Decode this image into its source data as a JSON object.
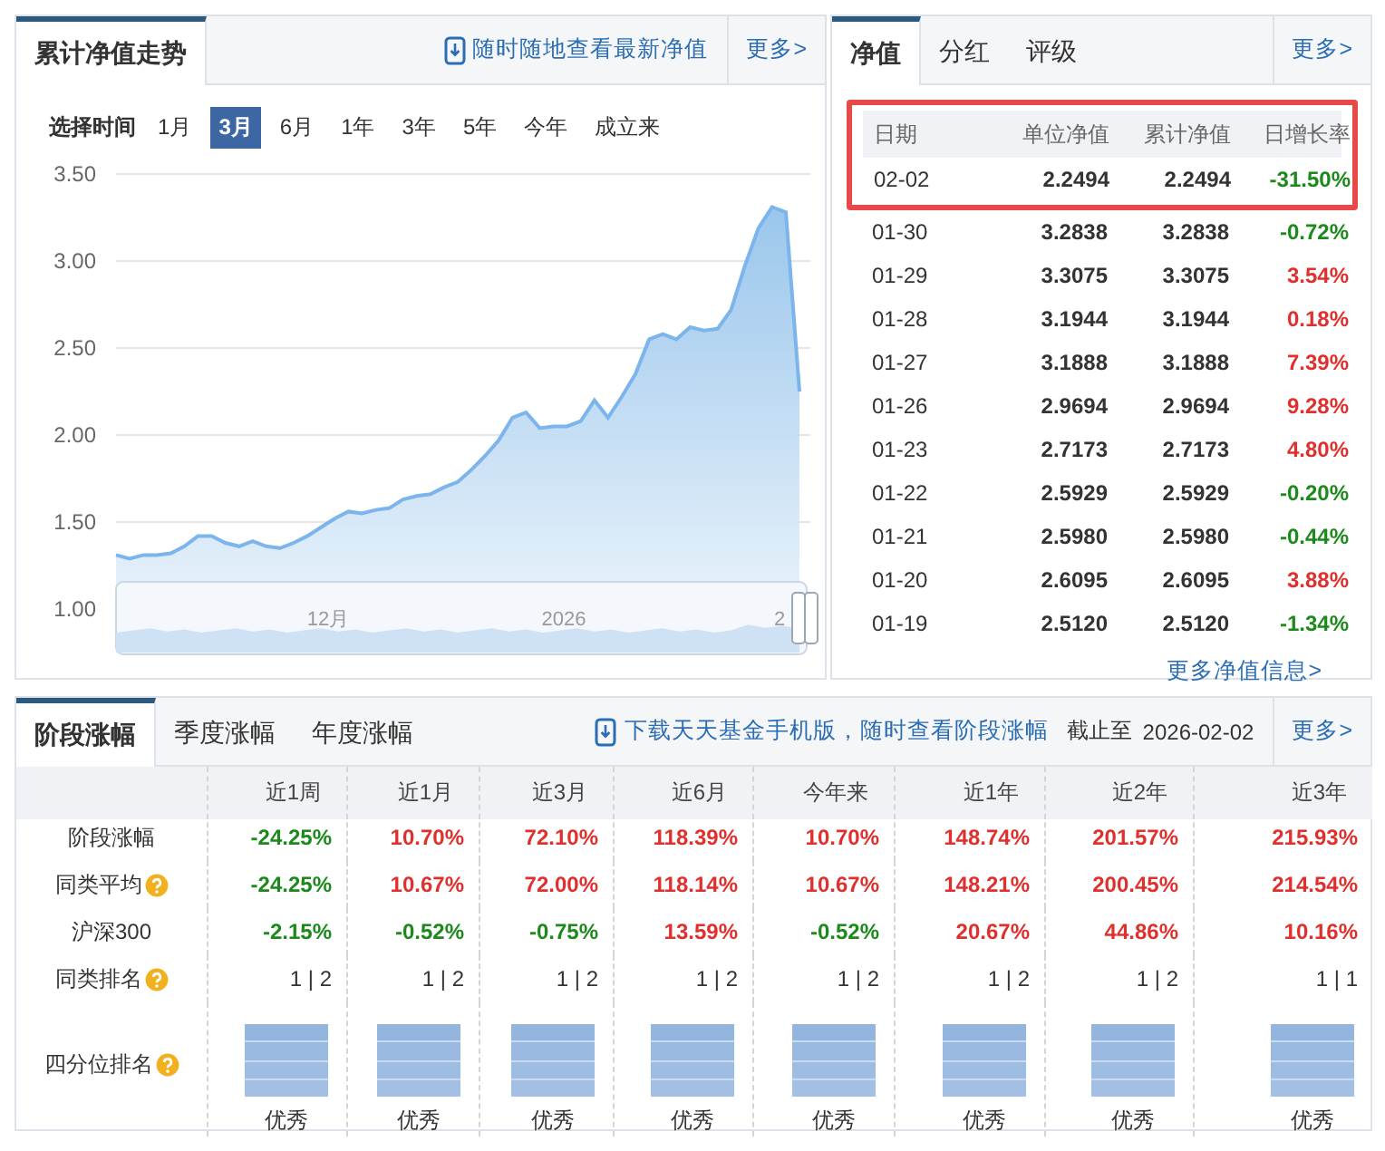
{
  "trend_panel": {
    "tabs": [
      {
        "label": "累计净值走势",
        "selected": true
      }
    ],
    "link": "随时随地查看最新净值",
    "more": "更多>",
    "range_label": "选择时间",
    "ranges": [
      {
        "label": "1月",
        "selected": false
      },
      {
        "label": "3月",
        "selected": true
      },
      {
        "label": "6月",
        "selected": false
      },
      {
        "label": "1年",
        "selected": false
      },
      {
        "label": "3年",
        "selected": false
      },
      {
        "label": "5年",
        "selected": false
      },
      {
        "label": "今年",
        "selected": false
      },
      {
        "label": "成立来",
        "selected": false
      }
    ],
    "chart_data": {
      "type": "area",
      "grid": true,
      "ylim": [
        1,
        3.5
      ],
      "yticks": [
        {
          "value": 1,
          "label": "1.00"
        },
        {
          "value": 1.5,
          "label": "1.50"
        },
        {
          "value": 2,
          "label": "2.00"
        },
        {
          "value": 2.5,
          "label": "2.50"
        },
        {
          "value": 3,
          "label": "3.00"
        },
        {
          "value": 3.5,
          "label": "3.50"
        }
      ],
      "series": [
        {
          "color": "#7cb5ec",
          "values": [
            1.31,
            1.29,
            1.31,
            1.31,
            1.32,
            1.36,
            1.42,
            1.42,
            1.38,
            1.36,
            1.39,
            1.36,
            1.35,
            1.38,
            1.42,
            1.47,
            1.52,
            1.56,
            1.55,
            1.57,
            1.58,
            1.63,
            1.65,
            1.66,
            1.7,
            1.73,
            1.8,
            1.88,
            1.97,
            2.1,
            2.13,
            2.04,
            2.05,
            2.05,
            2.08,
            2.2,
            2.1,
            2.22,
            2.35,
            2.55,
            2.58,
            2.55,
            2.62,
            2.6,
            2.61,
            2.72,
            2.97,
            3.19,
            3.31,
            3.28,
            2.25
          ]
        }
      ]
    },
    "navigator_labels": [
      "12月",
      "2026",
      "2"
    ]
  },
  "nav_panel": {
    "tabs": [
      {
        "label": "净值",
        "selected": true
      },
      {
        "label": "分红",
        "selected": false
      },
      {
        "label": "评级",
        "selected": false
      }
    ],
    "more": "更多>",
    "columns": [
      "日期",
      "单位净值",
      "累计净值",
      "日增长率"
    ],
    "rows": [
      {
        "date": "02-02",
        "unit": "2.2494",
        "accum": "2.2494",
        "change": "-31.50%",
        "color": "#1b8a1b",
        "highlighted": true
      },
      {
        "date": "01-30",
        "unit": "3.2838",
        "accum": "3.2838",
        "change": "-0.72%",
        "color": "#1b8a1b",
        "highlighted": false
      },
      {
        "date": "01-29",
        "unit": "3.3075",
        "accum": "3.3075",
        "change": "3.54%",
        "color": "#e0302d",
        "highlighted": false
      },
      {
        "date": "01-28",
        "unit": "3.1944",
        "accum": "3.1944",
        "change": "0.18%",
        "color": "#e0302d",
        "highlighted": false
      },
      {
        "date": "01-27",
        "unit": "3.1888",
        "accum": "3.1888",
        "change": "7.39%",
        "color": "#e0302d",
        "highlighted": false
      },
      {
        "date": "01-26",
        "unit": "2.9694",
        "accum": "2.9694",
        "change": "9.28%",
        "color": "#e0302d",
        "highlighted": false
      },
      {
        "date": "01-23",
        "unit": "2.7173",
        "accum": "2.7173",
        "change": "4.80%",
        "color": "#e0302d",
        "highlighted": false
      },
      {
        "date": "01-22",
        "unit": "2.5929",
        "accum": "2.5929",
        "change": "-0.20%",
        "color": "#1b8a1b",
        "highlighted": false
      },
      {
        "date": "01-21",
        "unit": "2.5980",
        "accum": "2.5980",
        "change": "-0.44%",
        "color": "#1b8a1b",
        "highlighted": false
      },
      {
        "date": "01-20",
        "unit": "2.6095",
        "accum": "2.6095",
        "change": "3.88%",
        "color": "#e0302d",
        "highlighted": false
      },
      {
        "date": "01-19",
        "unit": "2.5120",
        "accum": "2.5120",
        "change": "-1.34%",
        "color": "#1b8a1b",
        "highlighted": false
      }
    ],
    "link": "更多净值信息>"
  },
  "returns_panel": {
    "tabs": [
      {
        "label": "阶段涨幅",
        "selected": true
      },
      {
        "label": "季度涨幅",
        "selected": false
      },
      {
        "label": "年度涨幅",
        "selected": false
      }
    ],
    "link": "下载天天基金手机版，随时查看阶段涨幅",
    "as_of_label": "截止至",
    "as_of": "2026-02-02",
    "more": "更多>",
    "columns": [
      "近1周",
      "近1月",
      "近3月",
      "近6月",
      "今年来",
      "近1年",
      "近2年",
      "近3年"
    ],
    "rows": [
      {
        "label": "阶段涨幅",
        "help": false,
        "kind": "percent",
        "cells": [
          {
            "text": "-24.25%",
            "color": "#1b8a1b"
          },
          {
            "text": "10.70%",
            "color": "#e0302d"
          },
          {
            "text": "72.10%",
            "color": "#e0302d"
          },
          {
            "text": "118.39%",
            "color": "#e0302d"
          },
          {
            "text": "10.70%",
            "color": "#e0302d"
          },
          {
            "text": "148.74%",
            "color": "#e0302d"
          },
          {
            "text": "201.57%",
            "color": "#e0302d"
          },
          {
            "text": "215.93%",
            "color": "#e0302d"
          }
        ]
      },
      {
        "label": "同类平均",
        "help": true,
        "kind": "percent",
        "cells": [
          {
            "text": "-24.25%",
            "color": "#1b8a1b"
          },
          {
            "text": "10.67%",
            "color": "#e0302d"
          },
          {
            "text": "72.00%",
            "color": "#e0302d"
          },
          {
            "text": "118.14%",
            "color": "#e0302d"
          },
          {
            "text": "10.67%",
            "color": "#e0302d"
          },
          {
            "text": "148.21%",
            "color": "#e0302d"
          },
          {
            "text": "200.45%",
            "color": "#e0302d"
          },
          {
            "text": "214.54%",
            "color": "#e0302d"
          }
        ]
      },
      {
        "label": "沪深300",
        "help": false,
        "kind": "percent",
        "cells": [
          {
            "text": "-2.15%",
            "color": "#1b8a1b"
          },
          {
            "text": "-0.52%",
            "color": "#1b8a1b"
          },
          {
            "text": "-0.75%",
            "color": "#1b8a1b"
          },
          {
            "text": "13.59%",
            "color": "#e0302d"
          },
          {
            "text": "-0.52%",
            "color": "#1b8a1b"
          },
          {
            "text": "20.67%",
            "color": "#e0302d"
          },
          {
            "text": "44.86%",
            "color": "#e0302d"
          },
          {
            "text": "10.16%",
            "color": "#e0302d"
          }
        ]
      },
      {
        "label": "同类排名",
        "help": true,
        "kind": "rank",
        "cells": [
          {
            "text": "1 | 2"
          },
          {
            "text": "1 | 2"
          },
          {
            "text": "1 | 2"
          },
          {
            "text": "1 | 2"
          },
          {
            "text": "1 | 2"
          },
          {
            "text": "1 | 2"
          },
          {
            "text": "1 | 2"
          },
          {
            "text": "1 | 1"
          }
        ]
      },
      {
        "label": "四分位排名",
        "help": true,
        "kind": "quartile",
        "cells": [
          {
            "level": 1,
            "text": "优秀"
          },
          {
            "level": 1,
            "text": "优秀"
          },
          {
            "level": 1,
            "text": "优秀"
          },
          {
            "level": 1,
            "text": "优秀"
          },
          {
            "level": 1,
            "text": "优秀"
          },
          {
            "level": 1,
            "text": "优秀"
          },
          {
            "level": 1,
            "text": "优秀"
          },
          {
            "level": 1,
            "text": "优秀"
          }
        ]
      }
    ]
  }
}
